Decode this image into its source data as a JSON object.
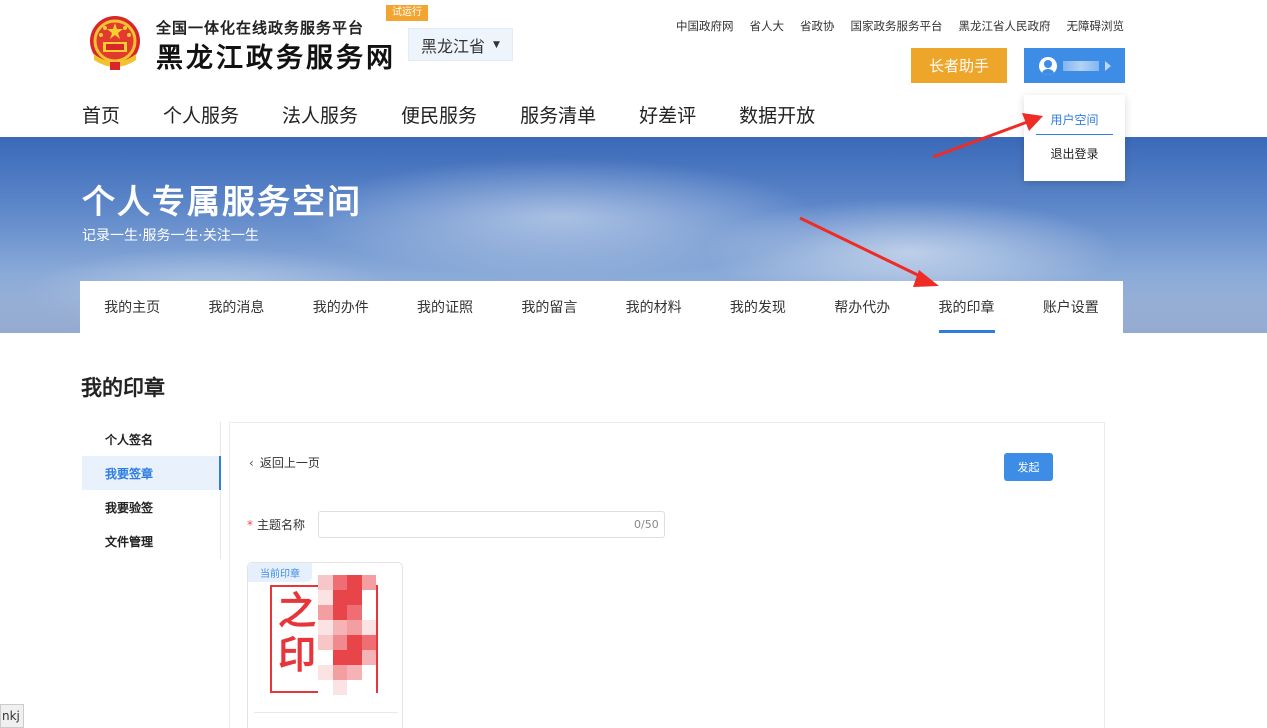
{
  "header": {
    "platform_name": "全国一体化在线政务服务平台",
    "site_name": "黑龙江政务服务网",
    "trial_badge": "试运行",
    "province": "黑龙江省",
    "top_links": [
      "中国政府网",
      "省人大",
      "省政协",
      "国家政务服务平台",
      "黑龙江省人民政府",
      "无障碍浏览"
    ],
    "elder_button": "长者助手",
    "user_dropdown": {
      "user_space": "用户空间",
      "logout": "退出登录"
    },
    "main_nav": [
      "首页",
      "个人服务",
      "法人服务",
      "便民服务",
      "服务清单",
      "好差评",
      "数据开放"
    ]
  },
  "banner": {
    "title": "个人专属服务空间",
    "subtitle": "记录一生·服务一生·关注一生"
  },
  "sub_nav": {
    "tabs": [
      "我的主页",
      "我的消息",
      "我的办件",
      "我的证照",
      "我的留言",
      "我的材料",
      "我的发现",
      "帮办代办",
      "我的印章",
      "账户设置"
    ],
    "active": "我的印章"
  },
  "content": {
    "section_title": "我的印章",
    "side_menu": [
      "个人签名",
      "我要签章",
      "我要验签",
      "文件管理"
    ],
    "side_active": "我要签章",
    "back_link": "返回上一页",
    "launch_button": "发起",
    "field_label": "主题名称",
    "field_value": "",
    "char_count": "0/50",
    "seal_tag": "当前印章",
    "seal_chars": [
      "之",
      "印"
    ]
  },
  "corner_tag": "nkj",
  "colors": {
    "accent": "#3d8de6",
    "elder": "#eda62a",
    "trial": "#f3a531",
    "seal_red": "#e8353b",
    "annotation_red": "#ee2b24"
  }
}
